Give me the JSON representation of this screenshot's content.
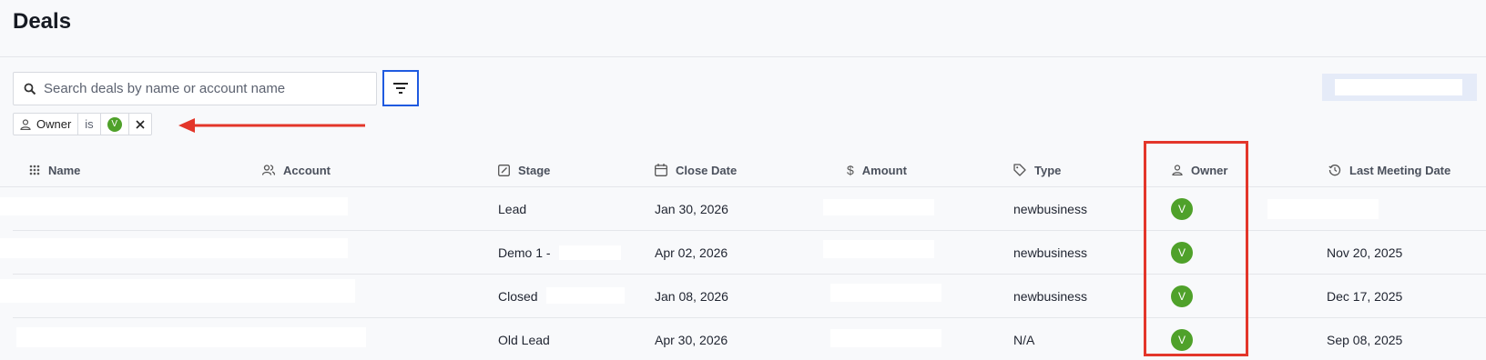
{
  "header": {
    "title": "Deals"
  },
  "search": {
    "placeholder": "Search deals by name or account name",
    "value": ""
  },
  "filter_chip": {
    "field": "Owner",
    "operator": "is",
    "value_initial": "V"
  },
  "columns": [
    "Name",
    "Account",
    "Stage",
    "Close Date",
    "Amount",
    "Type",
    "Owner",
    "Last Meeting Date"
  ],
  "rows": [
    {
      "stage": "Lead",
      "close_date": "Jan 30, 2026",
      "type": "newbusiness",
      "owner": "V",
      "last_meeting": ""
    },
    {
      "stage": "Demo 1 -",
      "close_date": "Apr 02, 2026",
      "type": "newbusiness",
      "owner": "V",
      "last_meeting": "Nov 20, 2025"
    },
    {
      "stage": "Closed",
      "close_date": "Jan 08, 2026",
      "type": "newbusiness",
      "owner": "V",
      "last_meeting": "Dec 17, 2025"
    },
    {
      "stage": "Old Lead",
      "close_date": "Apr 30, 2026",
      "type": "N/A",
      "owner": "V",
      "last_meeting": "Sep 08, 2025"
    }
  ],
  "colors": {
    "accent": "#1f5ae0",
    "owner_avatar": "#4fa12a",
    "annotation": "#e3362a"
  }
}
